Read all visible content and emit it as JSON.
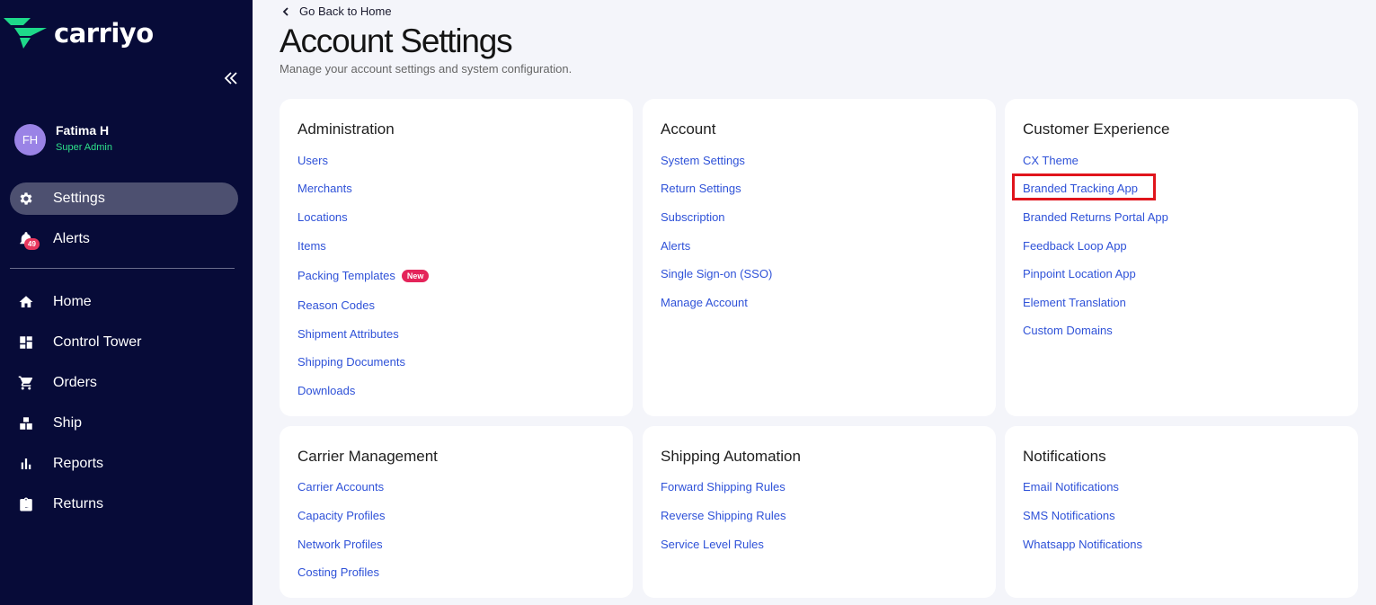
{
  "brand": {
    "name": "carriyo",
    "accent": "#1ed98a"
  },
  "sidebar": {
    "collapse_icon": "double-chevron-left-icon",
    "user": {
      "initials": "FH",
      "name": "Fatima H",
      "role": "Super Admin"
    },
    "top_items": [
      {
        "label": "Settings",
        "icon": "gear-icon",
        "active": true
      },
      {
        "label": "Alerts",
        "icon": "bell-icon",
        "badge": "49"
      }
    ],
    "items": [
      {
        "label": "Home",
        "icon": "home-icon"
      },
      {
        "label": "Control Tower",
        "icon": "dashboard-icon"
      },
      {
        "label": "Orders",
        "icon": "cart-icon"
      },
      {
        "label": "Ship",
        "icon": "boxes-icon"
      },
      {
        "label": "Reports",
        "icon": "bar-chart-icon"
      },
      {
        "label": "Returns",
        "icon": "return-box-icon"
      }
    ]
  },
  "header": {
    "back_label": "Go Back to Home",
    "title": "Account Settings",
    "subtitle": "Manage your account settings and system configuration."
  },
  "cards": [
    {
      "title": "Administration",
      "links": [
        {
          "label": "Users"
        },
        {
          "label": "Merchants"
        },
        {
          "label": "Locations"
        },
        {
          "label": "Items"
        },
        {
          "label": "Packing Templates",
          "badge": "New"
        },
        {
          "label": "Reason Codes"
        },
        {
          "label": "Shipment Attributes"
        },
        {
          "label": "Shipping Documents"
        },
        {
          "label": "Downloads"
        }
      ]
    },
    {
      "title": "Account",
      "links": [
        {
          "label": "System Settings"
        },
        {
          "label": "Return Settings"
        },
        {
          "label": "Subscription"
        },
        {
          "label": "Alerts"
        },
        {
          "label": "Single Sign-on (SSO)"
        },
        {
          "label": "Manage Account"
        }
      ]
    },
    {
      "title": "Customer Experience",
      "links": [
        {
          "label": "CX Theme"
        },
        {
          "label": "Branded Tracking App",
          "highlighted": true
        },
        {
          "label": "Branded Returns Portal App"
        },
        {
          "label": "Feedback Loop App"
        },
        {
          "label": "Pinpoint Location App"
        },
        {
          "label": "Element Translation"
        },
        {
          "label": "Custom Domains"
        }
      ]
    },
    {
      "title": "Carrier Management",
      "links": [
        {
          "label": "Carrier Accounts"
        },
        {
          "label": "Capacity Profiles"
        },
        {
          "label": "Network Profiles"
        },
        {
          "label": "Costing Profiles"
        }
      ]
    },
    {
      "title": "Shipping Automation",
      "links": [
        {
          "label": "Forward Shipping Rules"
        },
        {
          "label": "Reverse Shipping Rules"
        },
        {
          "label": "Service Level Rules"
        }
      ]
    },
    {
      "title": "Notifications",
      "links": [
        {
          "label": "Email Notifications"
        },
        {
          "label": "SMS Notifications"
        },
        {
          "label": "Whatsapp Notifications"
        }
      ]
    }
  ],
  "colors": {
    "sidebar_bg": "#070b38",
    "link": "#2f52d8",
    "highlight_border": "#e0151c",
    "new_badge": "#e4245a"
  }
}
